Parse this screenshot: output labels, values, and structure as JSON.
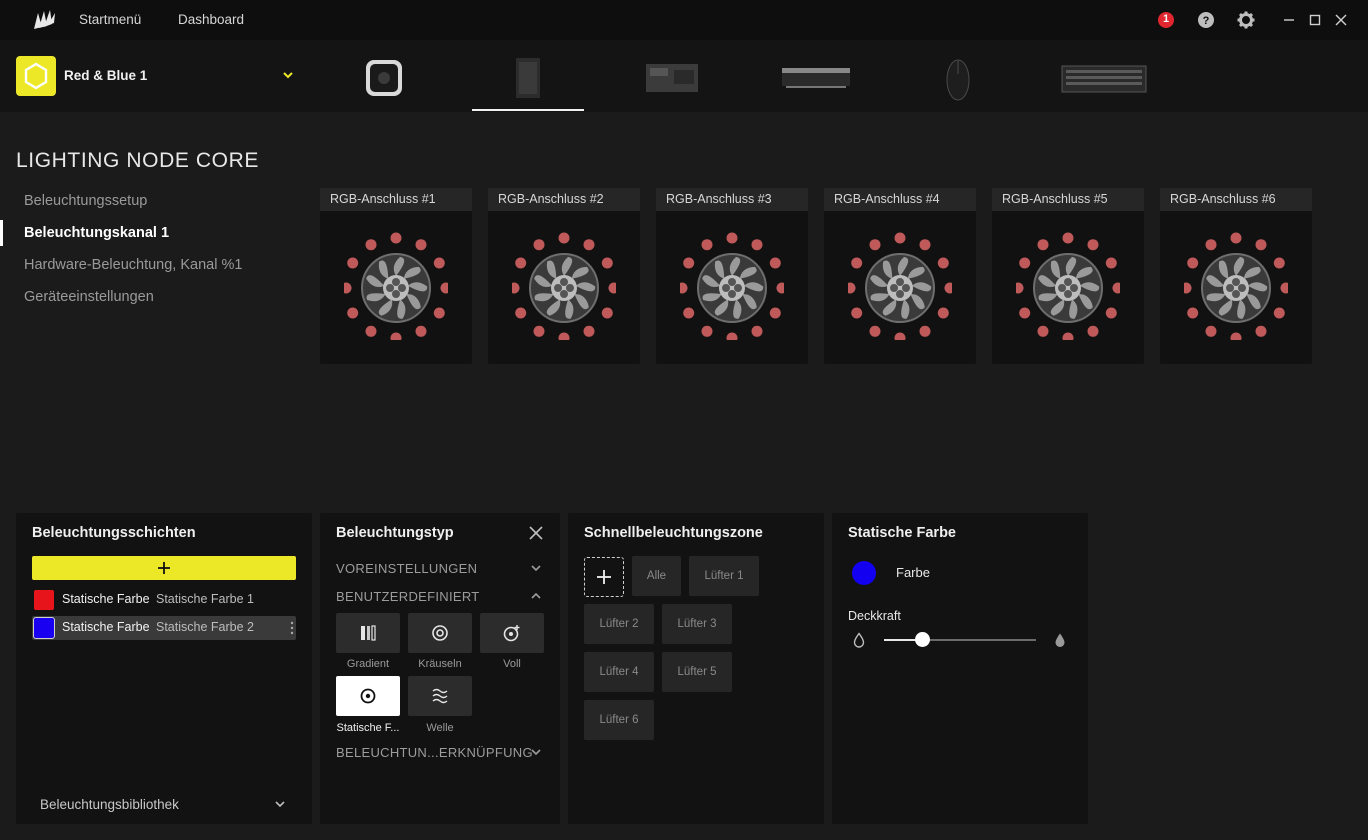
{
  "titlebar": {
    "nav": [
      "Startmenü",
      "Dashboard"
    ],
    "notification_count": "1"
  },
  "profile": {
    "name": "Red & Blue 1"
  },
  "page": {
    "title": "LIGHTING NODE CORE"
  },
  "sidebar": {
    "items": [
      {
        "label": "Beleuchtungssetup"
      },
      {
        "label": "Beleuchtungskanal 1"
      },
      {
        "label": "Hardware-Beleuchtung, Kanal %1"
      },
      {
        "label": "Geräteeinstellungen"
      }
    ]
  },
  "ports": [
    "RGB-Anschluss #1",
    "RGB-Anschluss #2",
    "RGB-Anschluss #3",
    "RGB-Anschluss #4",
    "RGB-Anschluss #5",
    "RGB-Anschluss #6"
  ],
  "layers_panel": {
    "title": "Beleuchtungsschichten",
    "layers": [
      {
        "name": "Statische Farbe",
        "sub": "Statische Farbe 1",
        "color": "#e8141c"
      },
      {
        "name": "Statische Farbe",
        "sub": "Statische Farbe 2",
        "color": "#1a00f0"
      }
    ],
    "library": "Beleuchtungsbibliothek"
  },
  "type_panel": {
    "title": "Beleuchtungstyp",
    "sections": [
      "VOREINSTELLUNGEN",
      "BENUTZERDEFINIERT",
      "BELEUCHTUN...ERKNÜPFUNG"
    ],
    "types": [
      {
        "label": "Gradient",
        "icon": "gradient-icon"
      },
      {
        "label": "Kräuseln",
        "icon": "ripple-icon"
      },
      {
        "label": "Voll",
        "icon": "full-icon"
      },
      {
        "label": "Statische F...",
        "icon": "static-color-icon"
      },
      {
        "label": "Welle",
        "icon": "wave-icon"
      }
    ]
  },
  "zone_panel": {
    "title": "Schnellbeleuchtungszone",
    "zones": [
      "Alle",
      "Lüfter 1",
      "Lüfter 2",
      "Lüfter 3",
      "Lüfter 4",
      "Lüfter 5",
      "Lüfter 6"
    ]
  },
  "color_panel": {
    "title": "Statische Farbe",
    "color_label": "Farbe",
    "color": "#1400f0",
    "opacity_label": "Deckkraft",
    "opacity": 0.25
  },
  "colors": {
    "accent": "#ece827",
    "notification": "#e0262e",
    "led": "#c05a5a"
  }
}
